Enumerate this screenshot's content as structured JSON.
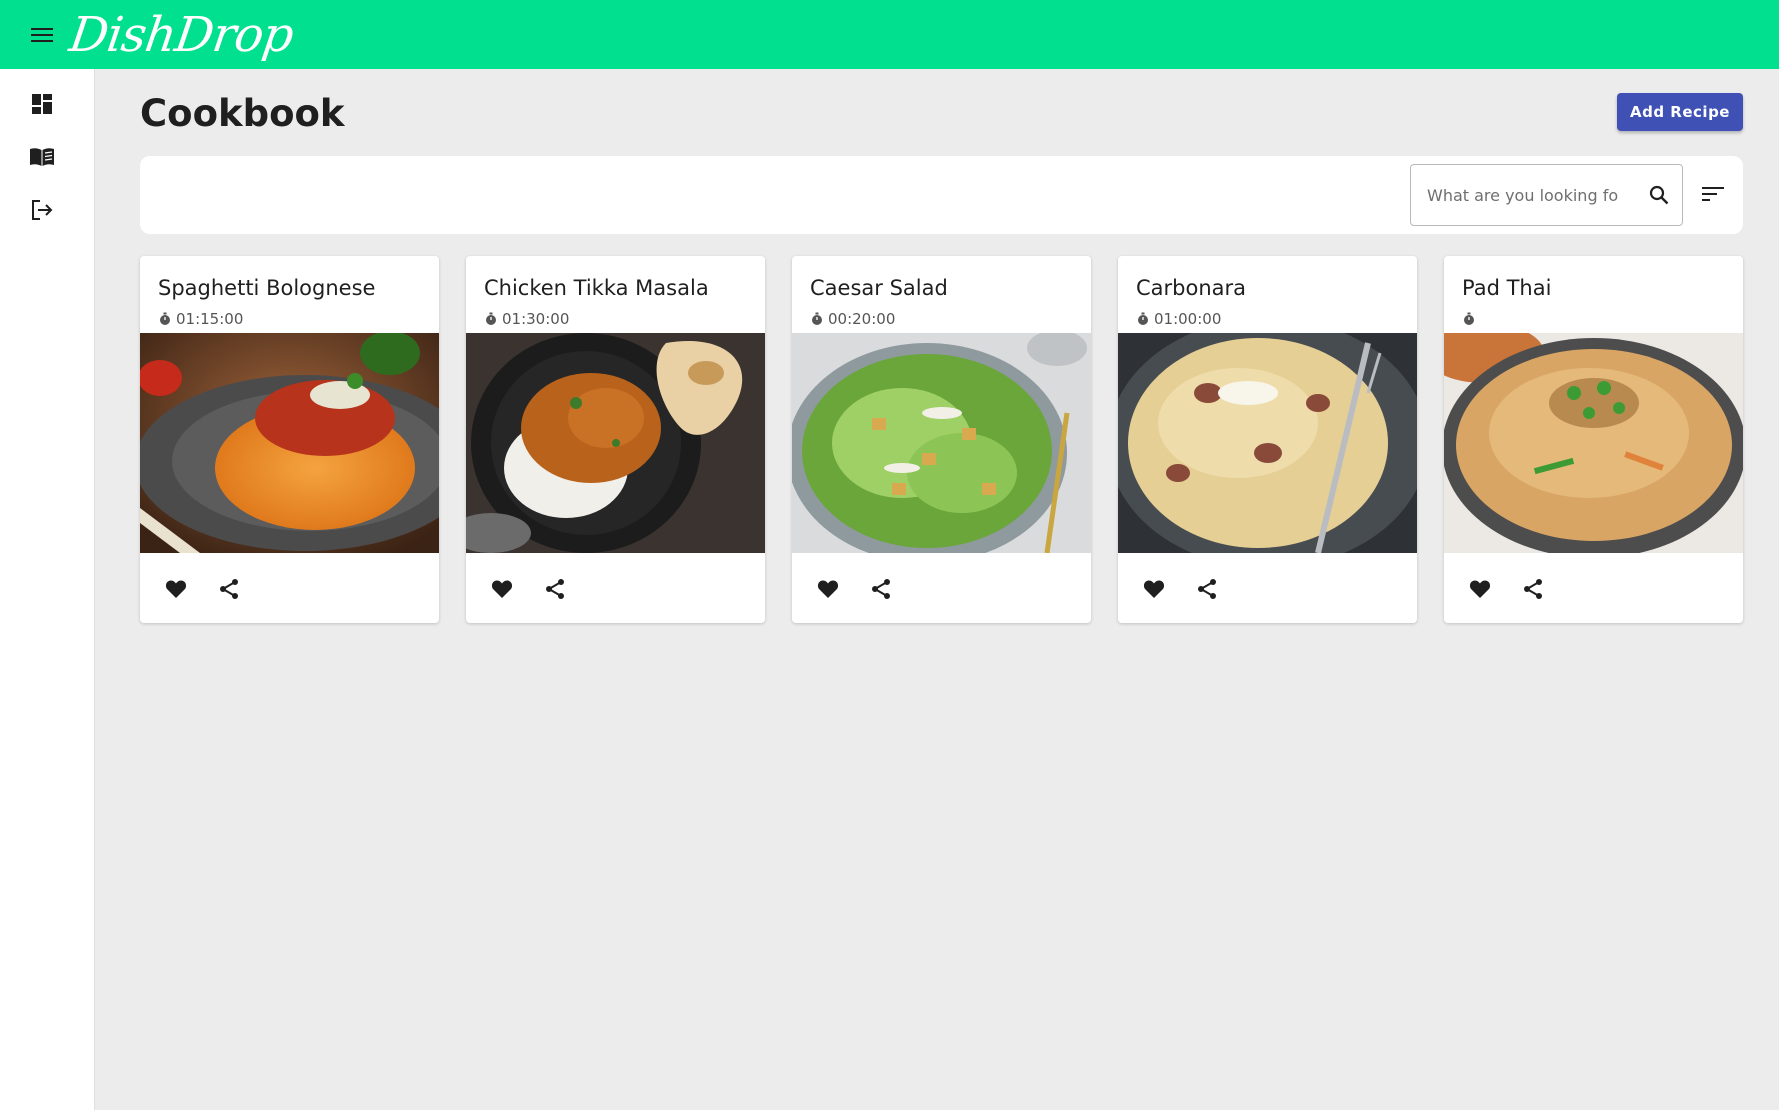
{
  "app": {
    "logo_text": "DishDrop",
    "brand_color": "#00e08e",
    "accent_color": "#3f51b5"
  },
  "appbar": {
    "menu_icon": "menu-icon"
  },
  "sidebar": {
    "items": [
      {
        "icon": "dashboard-icon"
      },
      {
        "icon": "cookbook-icon"
      },
      {
        "icon": "logout-icon"
      }
    ]
  },
  "page": {
    "title": "Cookbook",
    "add_button_label": "Add Recipe"
  },
  "search": {
    "placeholder": "What are you looking fo",
    "icon": "search-icon"
  },
  "sort": {
    "icon": "sort-icon"
  },
  "recipes": [
    {
      "title": "Spaghetti Bolognese",
      "time": "01:15:00",
      "image": "spaghetti-bolognese-photo"
    },
    {
      "title": "Chicken Tikka Masala",
      "time": "01:30:00",
      "image": "chicken-tikka-masala-photo"
    },
    {
      "title": "Caesar Salad",
      "time": "00:20:00",
      "image": "caesar-salad-photo"
    },
    {
      "title": "Carbonara",
      "time": "01:00:00",
      "image": "carbonara-photo"
    },
    {
      "title": "Pad Thai",
      "time": "",
      "image": "pad-thai-photo"
    }
  ]
}
